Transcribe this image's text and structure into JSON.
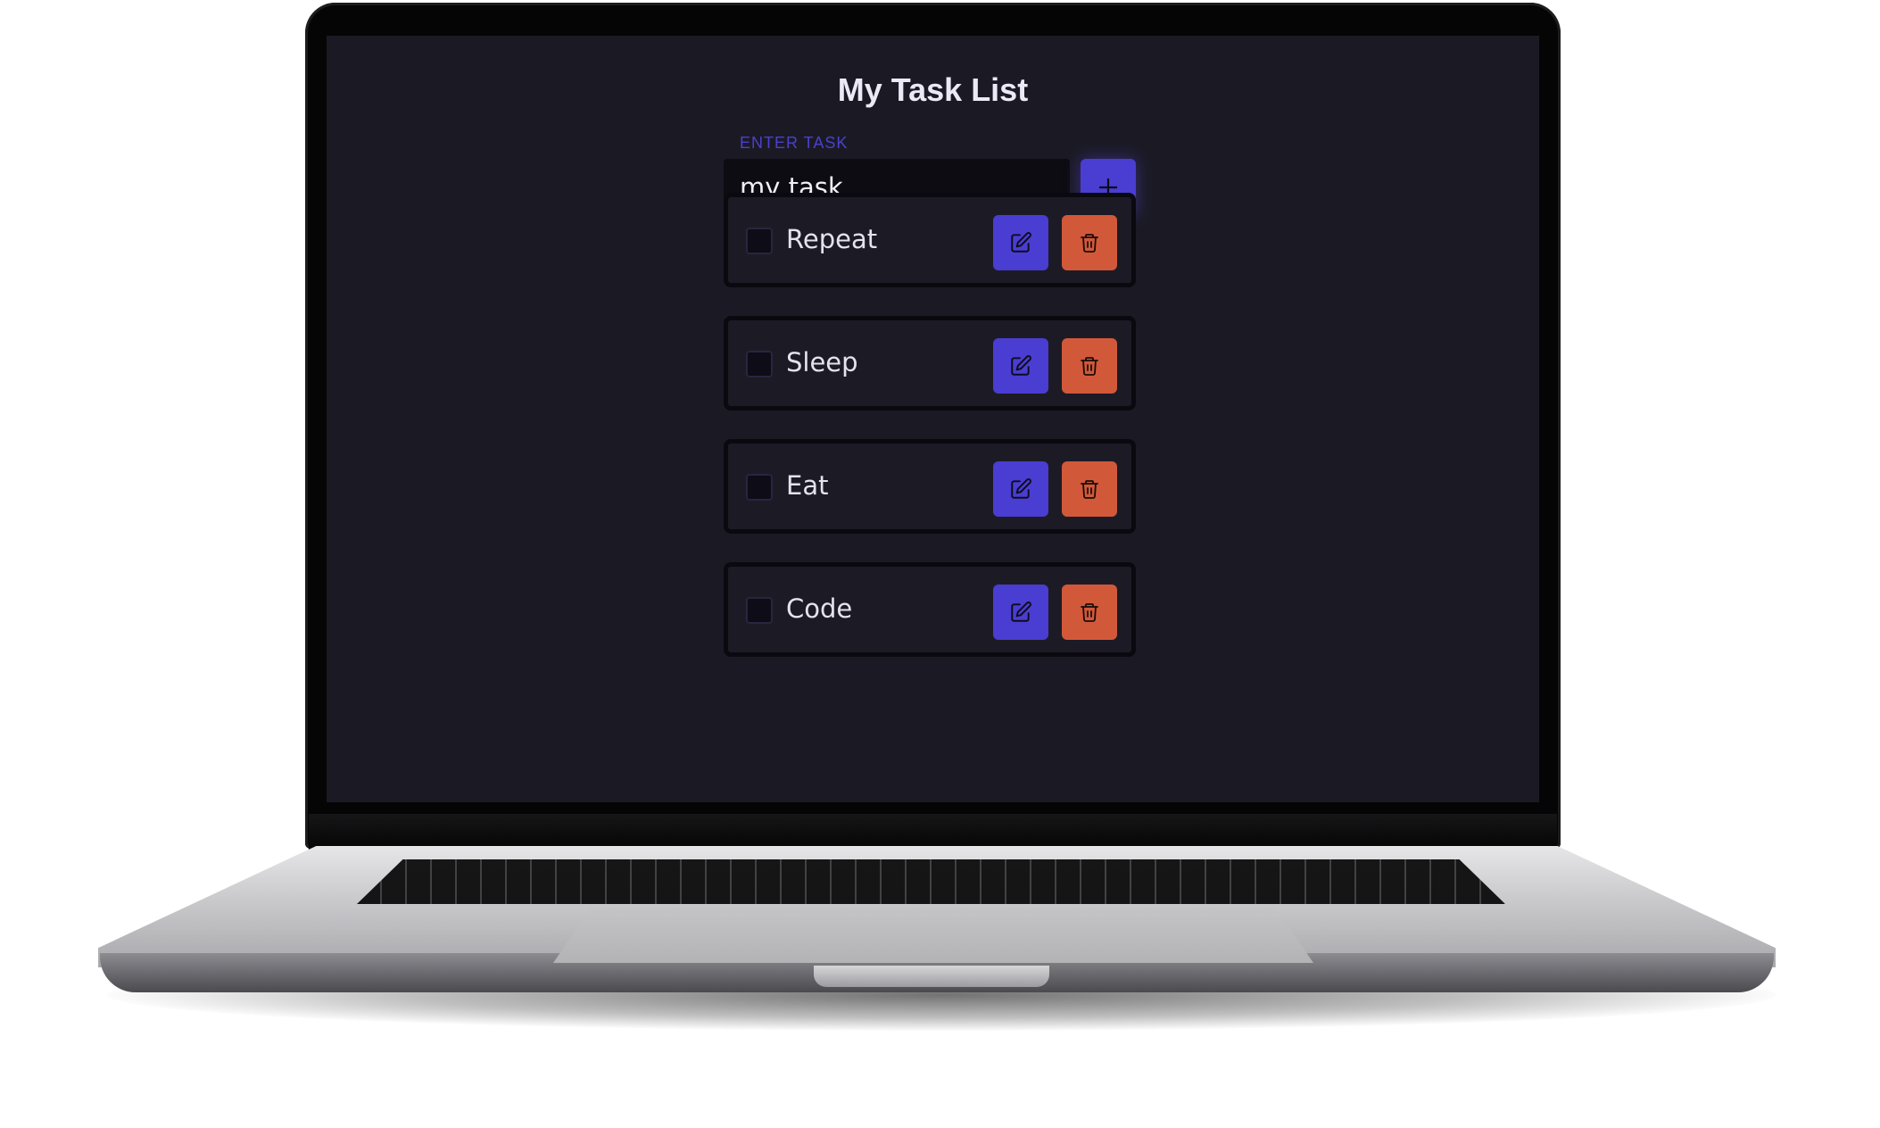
{
  "app": {
    "title": "My Task List",
    "input_label": "ENTER TASK",
    "input_value": "my task",
    "add_button_icon": "plus-icon",
    "edit_button_icon": "edit-icon",
    "delete_button_icon": "trash-icon"
  },
  "tasks": [
    {
      "label": "Repeat",
      "checked": false
    },
    {
      "label": "Sleep",
      "checked": false
    },
    {
      "label": "Eat",
      "checked": false
    },
    {
      "label": "Code",
      "checked": false
    }
  ],
  "colors": {
    "background": "#1b1a24",
    "accent": "#4a3dd2",
    "danger": "#d2583a",
    "label": "#4a40d0",
    "text": "#e4e2ee"
  }
}
